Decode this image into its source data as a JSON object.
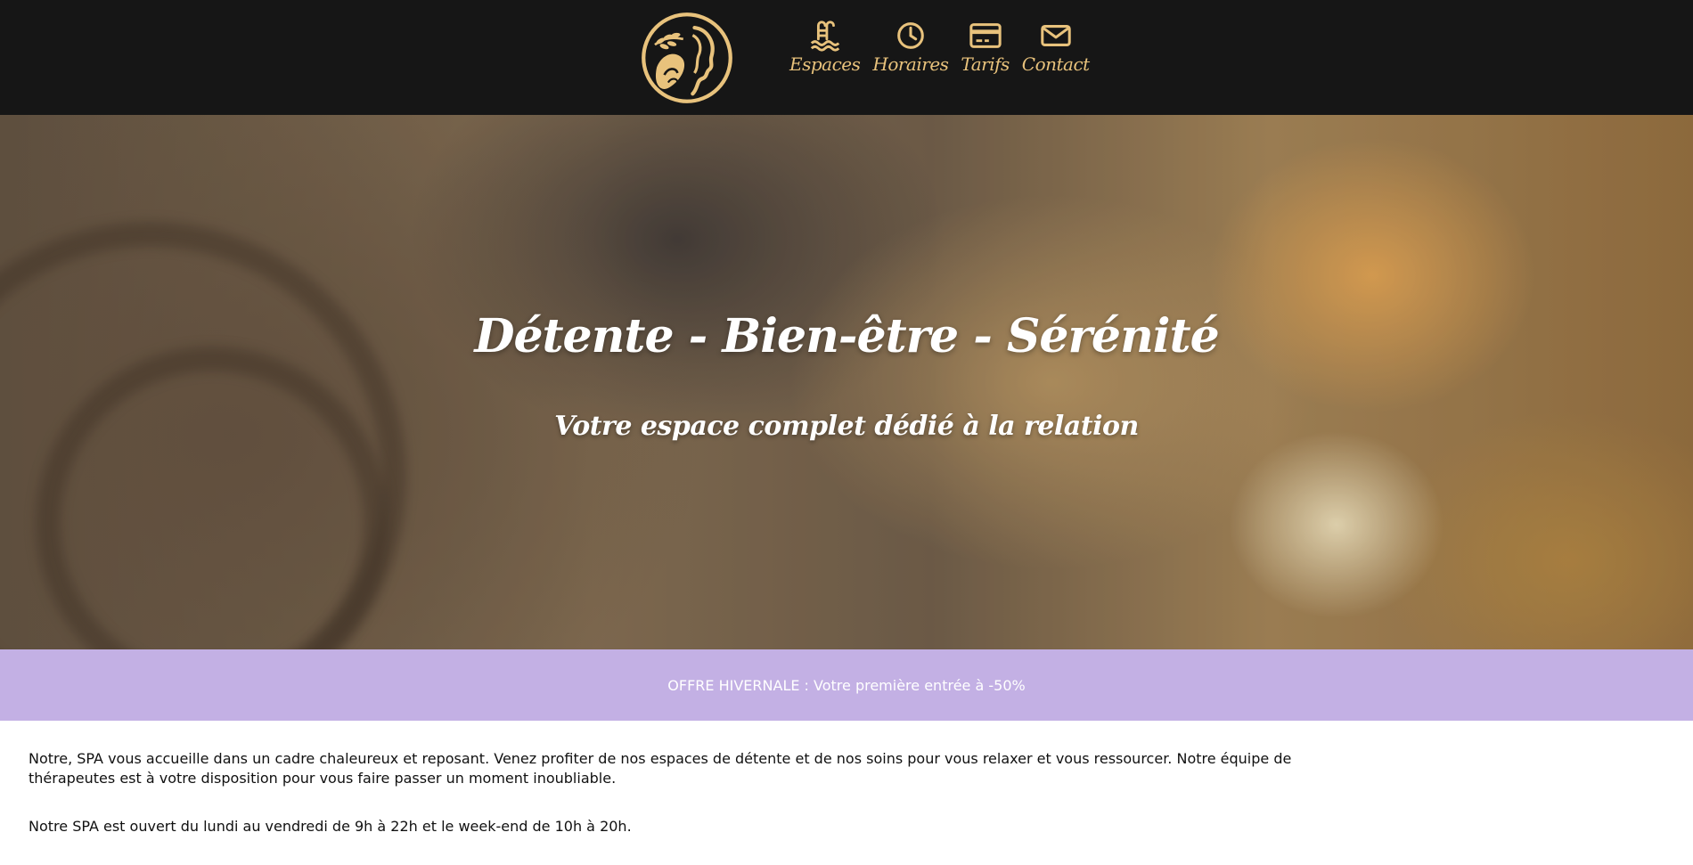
{
  "header": {
    "logo_name": "spa-logo",
    "nav": [
      {
        "label": "Espaces",
        "icon": "pool-ladder-icon"
      },
      {
        "label": "Horaires",
        "icon": "clock-icon"
      },
      {
        "label": "Tarifs",
        "icon": "credit-card-icon"
      },
      {
        "label": "Contact",
        "icon": "envelope-icon"
      }
    ]
  },
  "hero": {
    "title": "Détente - Bien-être - Sérénité",
    "subtitle": "Votre espace complet dédié à la relation"
  },
  "promo": {
    "text": "OFFRE HIVERNALE : Votre première entrée à -50%"
  },
  "content": {
    "paragraph1": "Notre, SPA vous accueille dans un cadre chaleureux et reposant. Venez profiter de nos espaces de détente et de nos soins pour vous relaxer et vous ressourcer. Notre équipe de thérapeutes est à votre disposition pour vous faire passer un moment inoubliable.",
    "paragraph2": "Notre SPA est ouvert du lundi au vendredi de 9h à 22h et le week-end de 10h à 20h."
  },
  "colors": {
    "header_bg": "#161616",
    "gold_accent": "#e8c27c",
    "promo_bg": "#c3b0e4"
  }
}
